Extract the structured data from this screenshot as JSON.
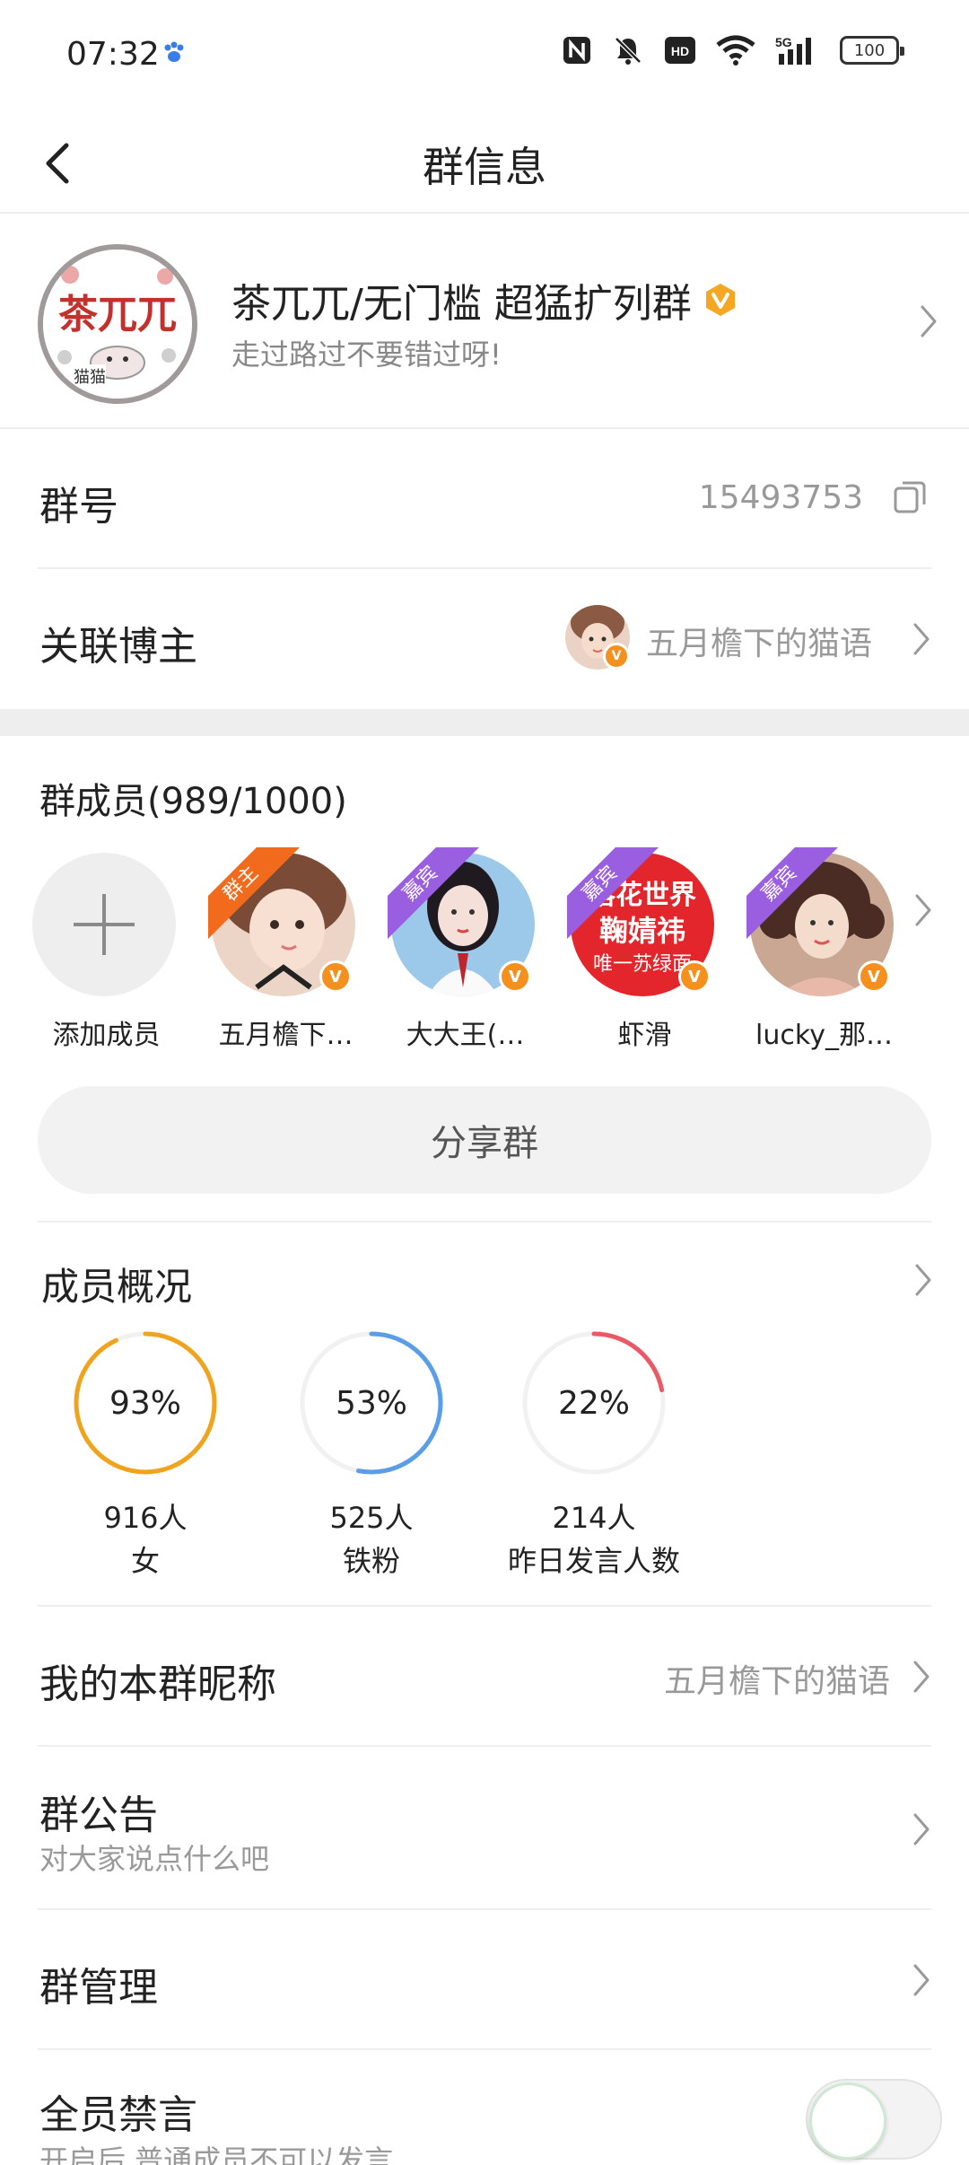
{
  "status_bar": {
    "time": "07:32",
    "battery": "100"
  },
  "header": {
    "title": "群信息"
  },
  "group": {
    "name": "茶兀兀/无门槛 超猛扩列群",
    "description": "走过路过不要错过呀!",
    "avatar_text": "茶兀兀",
    "avatar_sub": "猫猫"
  },
  "group_id": {
    "label": "群号",
    "value": "15493753"
  },
  "linked_blogger": {
    "label": "关联博主",
    "name": "五月檐下的猫语"
  },
  "members": {
    "title": "群成员(989/1000)",
    "add_label": "添加成员",
    "list": [
      {
        "name": "五月檐下…",
        "badge": "群主",
        "avatar_color": "#e9c9b8"
      },
      {
        "name": "大大王(…",
        "badge": "嘉宾",
        "avatar_color": "#9cc8ea"
      },
      {
        "name": "虾滑",
        "badge": "嘉宾",
        "avatar_color": "#e3262b",
        "avatar_text_1": "落花世界",
        "avatar_text_2": "鞠婧祎",
        "avatar_text_3": "唯一苏绿面"
      },
      {
        "name": "lucky_那…",
        "badge": "嘉宾",
        "avatar_color": "#c9a792"
      }
    ],
    "verified_mark": "V"
  },
  "share_button": "分享群",
  "overview": {
    "title": "成员概况",
    "stats": [
      {
        "percent": "93%",
        "fraction": 0.93,
        "count": "916人",
        "label": "女",
        "color": "#f0a31c"
      },
      {
        "percent": "53%",
        "fraction": 0.53,
        "count": "525人",
        "label": "铁粉",
        "color": "#5b9ee8"
      },
      {
        "percent": "22%",
        "fraction": 0.22,
        "count": "214人",
        "label": "昨日发言人数",
        "color": "#ea5a66"
      }
    ]
  },
  "my_nickname": {
    "label": "我的本群昵称",
    "value": "五月檐下的猫语"
  },
  "announcement": {
    "label": "群公告",
    "subtitle": "对大家说点什么吧"
  },
  "management": {
    "label": "群管理"
  },
  "mute_all": {
    "label": "全员禁言",
    "subtitle": "开启后,普通成员不可以发言",
    "enabled": false
  }
}
